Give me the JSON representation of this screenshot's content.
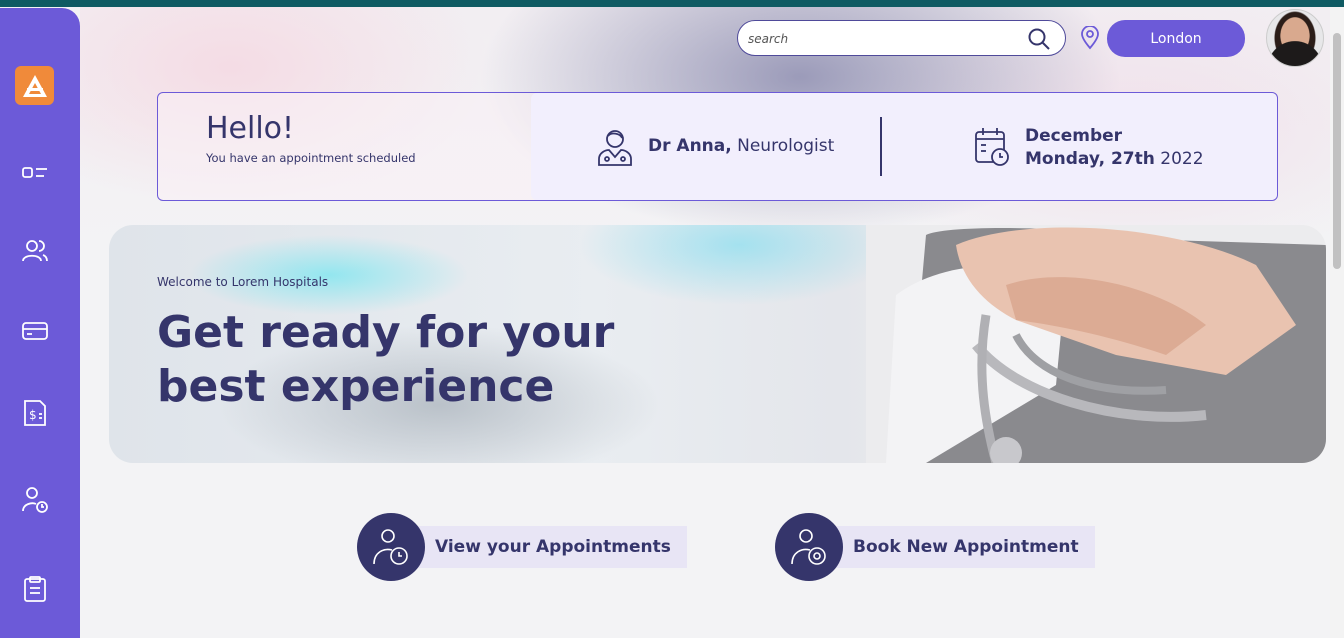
{
  "header": {
    "search_placeholder": "search",
    "location": "London"
  },
  "greeting": {
    "title": "Hello!",
    "subtitle": "You have an appointment scheduled",
    "doctor_name": "Dr Anna,",
    "doctor_specialty": "Neurologist",
    "month": "December",
    "day": "Monday, 27th",
    "year": "2022"
  },
  "hero": {
    "welcome": "Welcome to Lorem Hospitals",
    "title_line1": "Get ready for your",
    "title_line2": "best experience"
  },
  "actions": {
    "view": "View your Appointments",
    "book": "Book New Appointment"
  },
  "colors": {
    "sidebar": "#6c5ad8",
    "primary_text": "#35356b",
    "logo": "#f08a3a"
  }
}
